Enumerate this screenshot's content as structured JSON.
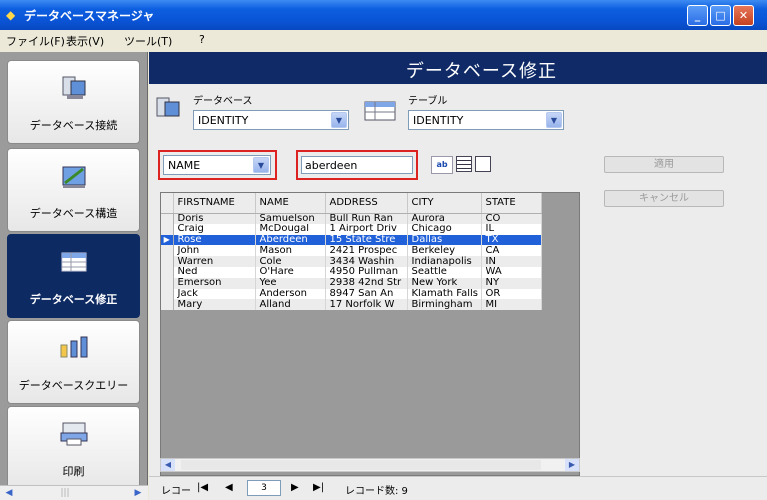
{
  "window": {
    "title": "データベースマネージャ"
  },
  "menu": [
    "ファイル(F)",
    "表示(V)",
    "ツール(T)",
    "?"
  ],
  "nav_items": [
    {
      "label": "データベース接続",
      "icon": "db-connect-icon",
      "active": false
    },
    {
      "label": "データベース構造",
      "icon": "db-structure-icon",
      "active": false
    },
    {
      "label": "データベース修正",
      "icon": "db-edit-icon",
      "active": true
    },
    {
      "label": "データベースクエリー",
      "icon": "db-query-icon",
      "active": false
    },
    {
      "label": "印刷",
      "icon": "print-icon",
      "active": false
    }
  ],
  "header": {
    "title": "データベース修正"
  },
  "database": {
    "label": "データベース",
    "value": "IDENTITY"
  },
  "table": {
    "label": "テーブル",
    "value": "IDENTITY"
  },
  "filter": {
    "field": "NAME",
    "value": "aberdeen"
  },
  "buttons": {
    "apply": "適用",
    "cancel": "キャンセル"
  },
  "grid": {
    "columns": [
      "FIRSTNAME",
      "NAME",
      "ADDRESS",
      "CITY",
      "STATE"
    ],
    "rows": [
      [
        "Doris",
        "Samuelson",
        "Bull Run Ran",
        "Aurora",
        "CO"
      ],
      [
        "Craig",
        "McDougal",
        "1 Airport Driv",
        "Chicago",
        "IL"
      ],
      [
        "Rose",
        "Aberdeen",
        "15 State Stre",
        "Dallas",
        "TX"
      ],
      [
        "John",
        "Mason",
        "2421 Prospec",
        "Berkeley",
        "CA"
      ],
      [
        "Warren",
        "Cole",
        "3434 Washin",
        "Indianapolis",
        "IN"
      ],
      [
        "Ned",
        "O'Hare",
        "4950 Pullman",
        "Seattle",
        "WA"
      ],
      [
        "Emerson",
        "Yee",
        "2938 42nd Str",
        "New York",
        "NY"
      ],
      [
        "Jack",
        "Anderson",
        "8947 San An",
        "Klamath Falls",
        "OR"
      ],
      [
        "Mary",
        "Alland",
        "17 Norfolk W",
        "Birmingham",
        "MI"
      ]
    ],
    "selected_row": 2
  },
  "navigator": {
    "label": "レコー",
    "page": "3",
    "count_label": "レコード数: 9"
  },
  "colors": {
    "header_bg": "#0f2a66",
    "selection": "#2060d8",
    "titlebar": "#0a54d6",
    "highlight_box": "#dd2222"
  }
}
